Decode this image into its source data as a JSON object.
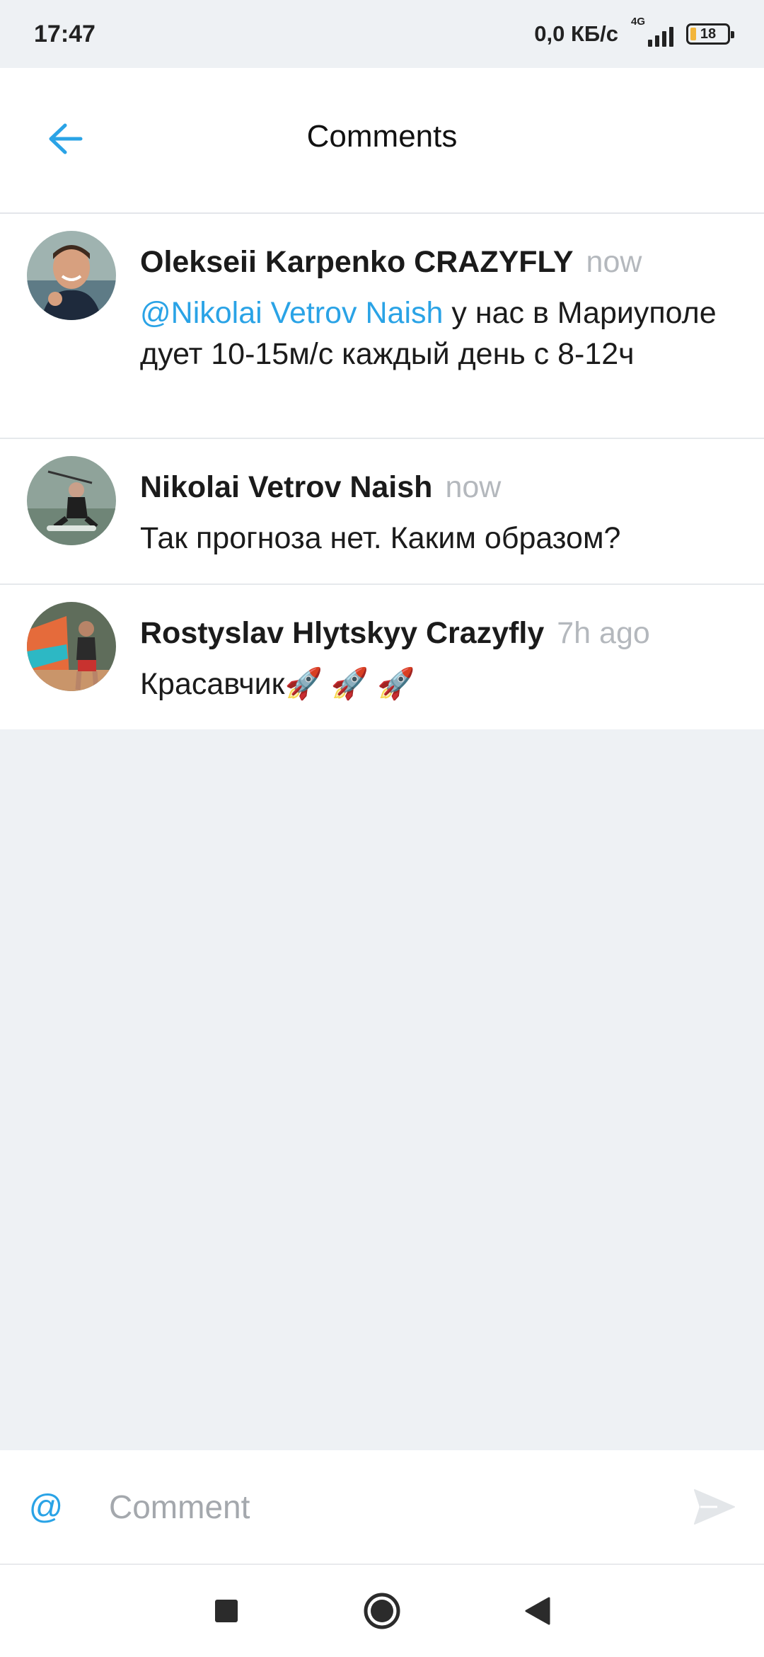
{
  "status_bar": {
    "time": "17:47",
    "net_speed": "0,0 КБ/с",
    "net_type": "4G",
    "battery_level": "18"
  },
  "header": {
    "title": "Comments",
    "back_icon": "arrow-left-icon"
  },
  "comments": [
    {
      "author": "Olekseii Karpenko CRAZYFLY",
      "time": "now",
      "mention": "@Nikolai Vetrov Naish",
      "text": " у нас в Мариуполе дует 10-15м/с каждый день с 8-12ч"
    },
    {
      "author": "Nikolai Vetrov Naish",
      "time": "now",
      "text": "Так прогноза нет. Каким образом?"
    },
    {
      "author": "Rostyslav Hlytskyy Crazyfly",
      "time": "7h ago",
      "text": "Красавчик🚀 🚀 🚀"
    }
  ],
  "composer": {
    "mention_symbol": "@",
    "placeholder": "Comment",
    "send_icon": "send-icon"
  },
  "nav": {
    "recents_icon": "square-icon",
    "home_icon": "circle-icon",
    "back_icon": "triangle-back-icon"
  },
  "colors": {
    "accent": "#2aa3e6",
    "background": "#eef1f4",
    "muted": "#b4b8bd"
  }
}
